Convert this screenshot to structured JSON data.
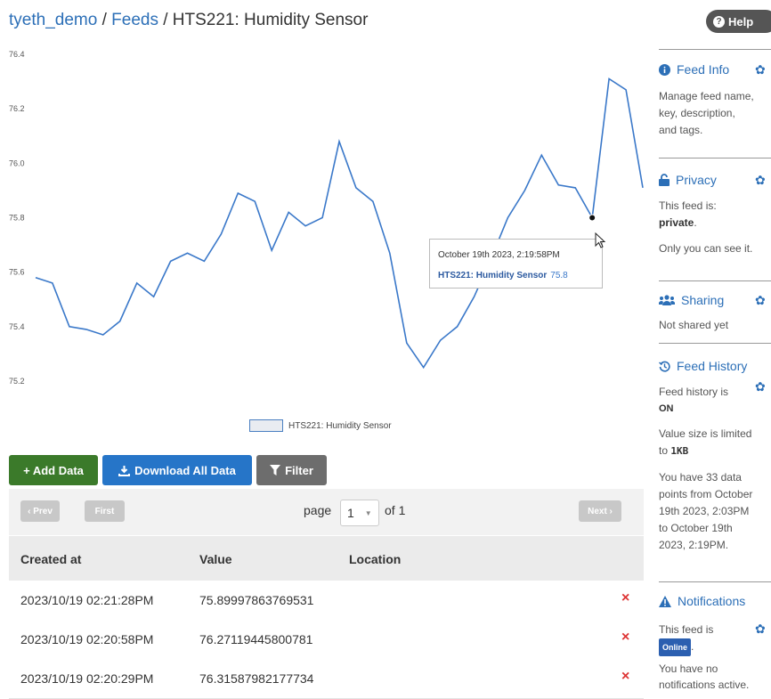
{
  "breadcrumb": {
    "user": "tyeth_demo",
    "sep1": "/",
    "feeds": "Feeds",
    "sep2": "/",
    "current": "HTS221: Humidity Sensor"
  },
  "help": {
    "label": "Help",
    "icon": "question-circle-icon"
  },
  "chart_data": {
    "type": "line",
    "series": [
      {
        "name": "HTS221: Humidity Sensor",
        "color": "#3a78c9",
        "values": [
          75.58,
          75.56,
          75.4,
          75.39,
          75.37,
          75.42,
          75.56,
          75.51,
          75.64,
          75.67,
          75.64,
          75.74,
          75.89,
          75.86,
          75.68,
          75.82,
          75.77,
          75.8,
          76.08,
          75.91,
          75.86,
          75.67,
          75.34,
          75.25,
          75.35,
          75.4,
          75.51,
          75.65,
          75.8,
          75.9,
          76.03,
          75.92,
          75.91,
          75.8,
          76.31,
          76.27,
          75.91
        ]
      }
    ],
    "yticks": [
      "76.4",
      "76.2",
      "76.0",
      "75.8",
      "75.6",
      "75.4",
      "75.2"
    ],
    "ylim": [
      75.2,
      76.4
    ],
    "grid": false,
    "legend": "bottom-center",
    "highlight_index": 33
  },
  "tooltip": {
    "time": "October 19th 2023, 2:19:58PM",
    "series": "HTS221: Humidity Sensor",
    "value": "75.8"
  },
  "legend": {
    "label": "HTS221: Humidity Sensor"
  },
  "actions": {
    "add": "+ Add Data",
    "download": "Download All Data",
    "filter": "Filter"
  },
  "pager": {
    "prev": "‹ Prev",
    "first": "First",
    "next": "Next ›",
    "page_label": "page",
    "page_value": "1",
    "of_label": "of 1"
  },
  "table": {
    "headers": [
      "Created at",
      "Value",
      "Location"
    ],
    "rows": [
      {
        "created": "2023/10/19 02:21:28PM",
        "value": "75.89997863769531",
        "location": ""
      },
      {
        "created": "2023/10/19 02:20:58PM",
        "value": "76.27119445800781",
        "location": ""
      },
      {
        "created": "2023/10/19 02:20:29PM",
        "value": "76.31587982177734",
        "location": ""
      }
    ],
    "delete_icon": "×"
  },
  "sidebar": {
    "feed_info": {
      "title": "Feed Info",
      "l1": "Manage feed name,",
      "l2": "key, description,",
      "l3": "and tags."
    },
    "privacy": {
      "title": "Privacy",
      "l1": "This feed is:",
      "l2": "private",
      "l2b": ".",
      "l3": "Only you can see it."
    },
    "sharing": {
      "title": "Sharing",
      "l1": "Not shared yet"
    },
    "history": {
      "title": "Feed History",
      "l1": "Feed history is",
      "l2": "ON",
      "l3": "Value size is limited",
      "l4a": "to ",
      "l4b": "1KB",
      "l5": "You have 33 data",
      "l6": "points from October",
      "l7": "19th 2023, 2:03PM",
      "l8": "to October 19th",
      "l9": "2023, 2:19PM."
    },
    "notifications": {
      "title": "Notifications",
      "l1": "This feed is",
      "badge": "Online",
      "l2b": ".",
      "l3": "You have no",
      "l4": "notifications active."
    }
  },
  "colors": {
    "link": "#2c6fb7",
    "add": "#3b7a2a",
    "download": "#2675c8",
    "filter": "#6d6d6d",
    "delete": "#d33333"
  }
}
